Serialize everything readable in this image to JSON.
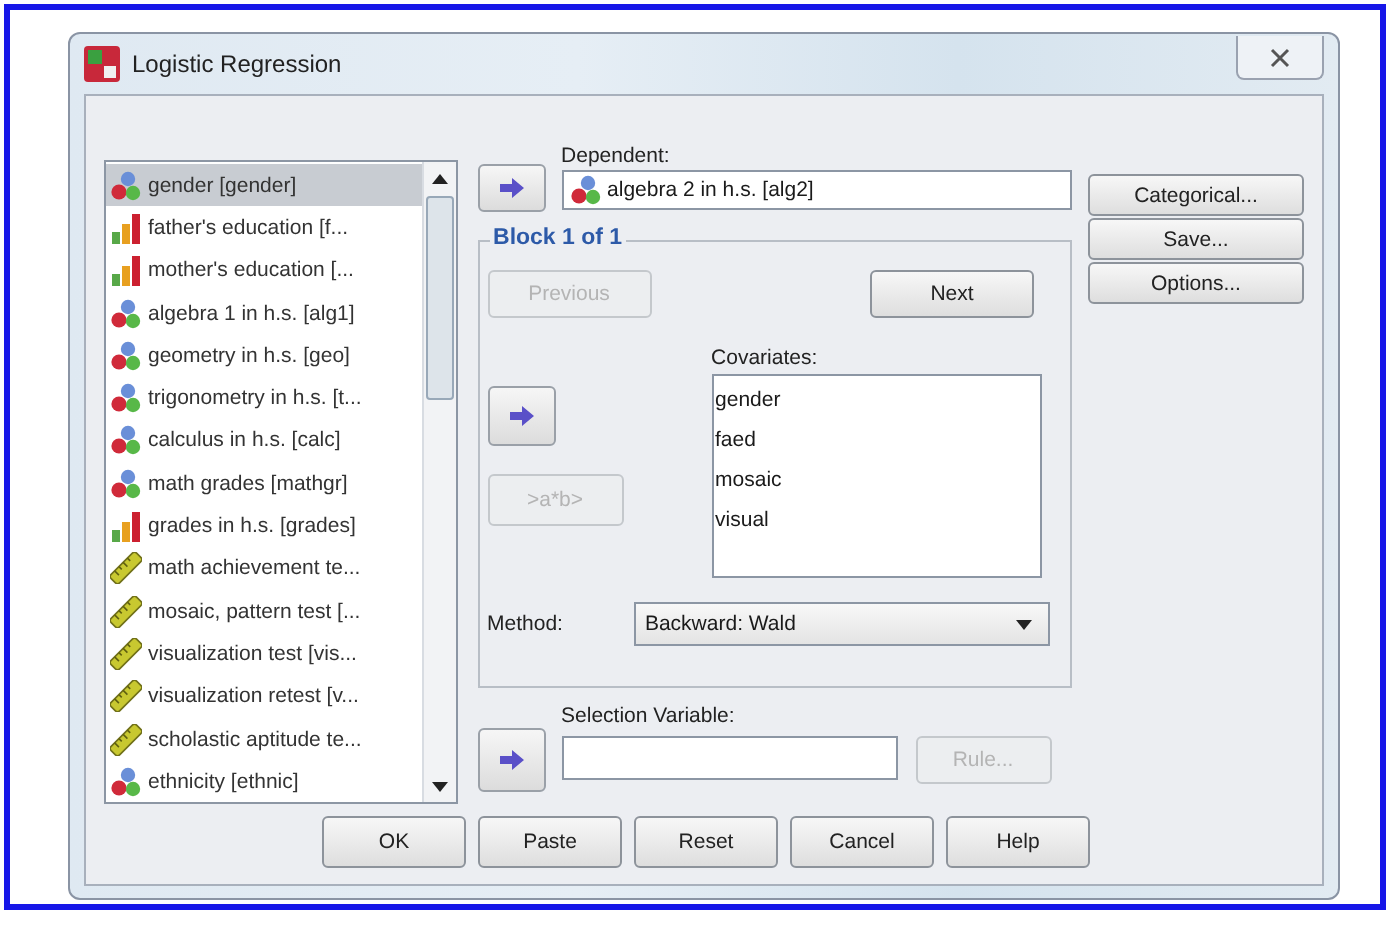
{
  "window": {
    "title": "Logistic Regression"
  },
  "variables": [
    {
      "label": "gender [gender]",
      "kind": "nominal",
      "selected": true
    },
    {
      "label": "father's education [f...",
      "kind": "ordinal",
      "selected": false
    },
    {
      "label": "mother's education [...",
      "kind": "ordinal",
      "selected": false
    },
    {
      "label": "algebra 1 in h.s. [alg1]",
      "kind": "nominal",
      "selected": false
    },
    {
      "label": "geometry in h.s. [geo]",
      "kind": "nominal",
      "selected": false
    },
    {
      "label": "trigonometry in h.s. [t...",
      "kind": "nominal",
      "selected": false
    },
    {
      "label": "calculus in h.s. [calc]",
      "kind": "nominal",
      "selected": false
    },
    {
      "label": "math grades [mathgr]",
      "kind": "nominal",
      "selected": false
    },
    {
      "label": "grades in h.s. [grades]",
      "kind": "ordinal",
      "selected": false
    },
    {
      "label": "math achievement te...",
      "kind": "scale",
      "selected": false
    },
    {
      "label": "mosaic, pattern test [...",
      "kind": "scale",
      "selected": false
    },
    {
      "label": "visualization test [vis...",
      "kind": "scale",
      "selected": false
    },
    {
      "label": "visualization retest [v...",
      "kind": "scale",
      "selected": false
    },
    {
      "label": "scholastic aptitude te...",
      "kind": "scale",
      "selected": false
    },
    {
      "label": "ethnicity [ethnic]",
      "kind": "nominal",
      "selected": false
    }
  ],
  "dependent": {
    "label": "Dependent:",
    "value": "algebra 2 in h.s. [alg2]",
    "kind": "nominal"
  },
  "block": {
    "title": "Block 1 of 1",
    "nav_buttons": [
      {
        "label": "Previous",
        "disabled": true
      },
      {
        "label": "Next",
        "disabled": false
      }
    ],
    "covariates_label": "Covariates:",
    "covariates": [
      "gender",
      "faed",
      "mosaic",
      "visual"
    ],
    "interaction_button": {
      "label": ">a*b>",
      "disabled": true
    },
    "method_label": "Method:",
    "method": "Backward: Wald"
  },
  "selection": {
    "label": "Selection Variable:",
    "rule_button": {
      "label": "Rule...",
      "disabled": true
    }
  },
  "side_buttons": [
    "Categorical...",
    "Save...",
    "Options..."
  ],
  "footer_buttons": [
    "OK",
    "Paste",
    "Reset",
    "Cancel",
    "Help"
  ]
}
